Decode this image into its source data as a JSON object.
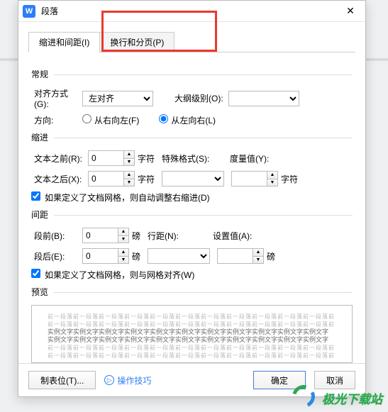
{
  "title": "段落",
  "app_icon_letter": "W",
  "tabs": {
    "indent": "缩进和间距(I)",
    "page": "换行和分页(P)"
  },
  "general": {
    "title": "常规",
    "align_label": "对齐方式(G):",
    "align_value": "左对齐",
    "outline_label": "大纲级别(O):",
    "outline_value": "",
    "direction_label": "方向:",
    "rtl": "从右向左(F)",
    "ltr": "从左向右(L)"
  },
  "indent": {
    "title": "缩进",
    "before_label": "文本之前(R):",
    "before_value": "0",
    "after_label": "文本之后(X):",
    "after_value": "0",
    "char_unit": "字符",
    "special_label": "特殊格式(S):",
    "special_value": "",
    "measure_label": "度量值(Y):",
    "measure_value": "",
    "auto_check": "如果定义了文档网格，则自动调整右缩进(D)"
  },
  "spacing": {
    "title": "间距",
    "before_label": "段前(B):",
    "before_value": "0",
    "after_label": "段后(E):",
    "after_value": "0",
    "row_unit": "磅",
    "line_label": "行距(N):",
    "line_value": "",
    "setval_label": "设置值(A):",
    "setval_value": "",
    "grid_check": "如果定义了文档网格，则与网格对齐(W)"
  },
  "preview": {
    "title": "预览",
    "gray_line": "前一段落前一段落前一段落前一段落前一段落前一段落前一段落前一段落前一段落前一段落前一段落前",
    "dark_line": "实例文字实例文字实例文字实例文字实例文字实例文字实例文字实例文字实例文字实例文字实例文字"
  },
  "footer": {
    "tabs_btn": "制表位(T)...",
    "tips": "操作技巧",
    "ok": "确定",
    "cancel": "取消"
  },
  "watermark": "极光下载站"
}
